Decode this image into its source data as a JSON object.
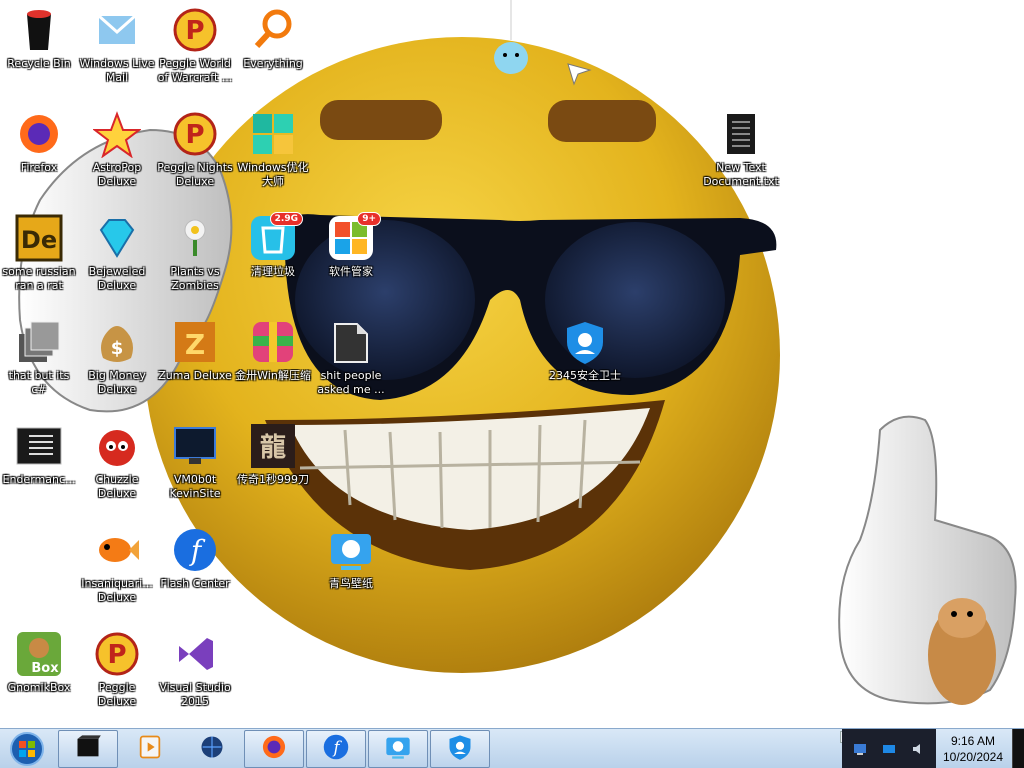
{
  "desktop": {
    "icons": [
      {
        "label": "Recycle Bin",
        "icon": "recycle-bin-icon"
      },
      {
        "label": "Windows Live Mail",
        "icon": "mail-icon"
      },
      {
        "label": "Peggle World of Warcraft ...",
        "icon": "peggle-icon"
      },
      {
        "label": "Everything",
        "icon": "search-icon"
      },
      {
        "label": "Firefox",
        "icon": "firefox-icon"
      },
      {
        "label": "AstroPop Deluxe",
        "icon": "astropop-icon"
      },
      {
        "label": "Peggle Nights Deluxe",
        "icon": "peggle-icon"
      },
      {
        "label": "Windows优化大师",
        "icon": "windows-tiles-icon"
      },
      {
        "label": "New Text Document.txt",
        "icon": "text-document-icon"
      },
      {
        "label": "some russian ran a rat",
        "icon": "de-icon"
      },
      {
        "label": "Bejeweled Deluxe",
        "icon": "gem-icon"
      },
      {
        "label": "Plants vs Zombies",
        "icon": "flower-icon"
      },
      {
        "label": "清理垃圾",
        "icon": "trash-cleaner-icon",
        "badge": "2.9G"
      },
      {
        "label": "软件管家",
        "icon": "software-manager-icon",
        "badge": "9+"
      },
      {
        "label": "that but its c#",
        "icon": "stack-icon"
      },
      {
        "label": "Big Money Deluxe",
        "icon": "money-bag-icon"
      },
      {
        "label": "Zuma Deluxe",
        "icon": "zuma-icon"
      },
      {
        "label": "金卅Win解压缩",
        "icon": "archive-icon"
      },
      {
        "label": "shit people asked me ...",
        "icon": "folder-icon"
      },
      {
        "label": "2345安全卫士",
        "icon": "shield-icon"
      },
      {
        "label": "Endermanc...",
        "icon": "terminal-icon"
      },
      {
        "label": "Chuzzle Deluxe",
        "icon": "chuzzle-icon"
      },
      {
        "label": "VM0b0t KevinSite",
        "icon": "monitor-icon"
      },
      {
        "label": "传奇1秒999刀",
        "icon": "dragon-icon"
      },
      {
        "label": "Insaniquari... Deluxe",
        "icon": "fish-icon"
      },
      {
        "label": "Flash Center",
        "icon": "flash-icon"
      },
      {
        "label": "青鸟壁纸",
        "icon": "wallpaper-app-icon"
      },
      {
        "label": "GnomikBox",
        "icon": "gnomikbox-icon"
      },
      {
        "label": "Peggle Deluxe",
        "icon": "peggle-icon"
      },
      {
        "label": "Visual Studio 2015",
        "icon": "visual-studio-icon"
      }
    ]
  },
  "taskbar": {
    "buttons": [
      {
        "icon": "black-box-icon"
      },
      {
        "icon": "media-player-icon"
      },
      {
        "icon": "globe-icon"
      },
      {
        "icon": "firefox-icon"
      },
      {
        "icon": "flash-icon"
      },
      {
        "icon": "wallpaper-app-icon"
      },
      {
        "icon": "shield-icon"
      }
    ],
    "clock": {
      "time": "9:16 AM",
      "date": "10/20/2024"
    }
  },
  "colors": {
    "smiley": "#e8b81a",
    "taskbar": "#c6dbf0"
  }
}
